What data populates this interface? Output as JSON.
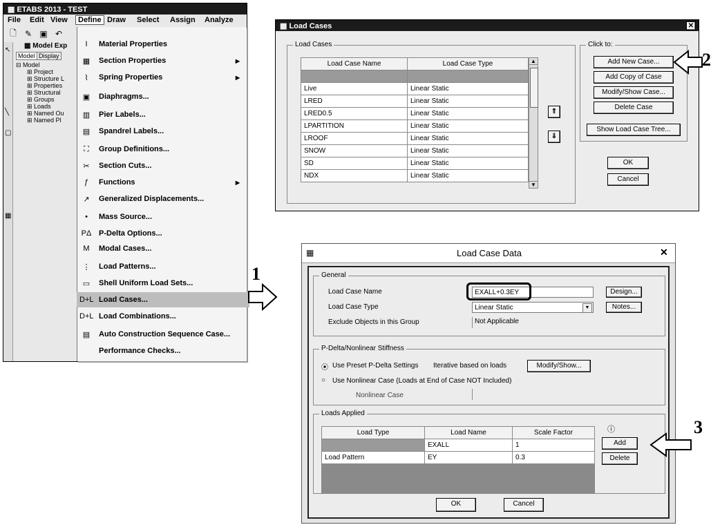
{
  "etabs": {
    "title": "ETABS 2013 - TEST",
    "menubar": [
      "File",
      "Edit",
      "View",
      "Define",
      "Draw",
      "Select",
      "Assign",
      "Analyze"
    ],
    "explorer_title": "Model Exp",
    "explorer_tabs": [
      "Model",
      "Display"
    ],
    "tree": [
      "Model",
      "Project",
      "Structure L",
      "Properties",
      "Structural",
      "Groups",
      "Loads",
      "Named Ou",
      "Named Pl"
    ],
    "define_menu": [
      {
        "label": "Material Properties",
        "icon": "I",
        "submenu": false
      },
      {
        "label": "Section Properties",
        "icon": "▦",
        "submenu": true
      },
      {
        "label": "Spring Properties",
        "icon": "⌇",
        "submenu": true
      },
      {
        "label": "Diaphragms...",
        "icon": "▣",
        "submenu": false
      },
      {
        "label": "Pier Labels...",
        "icon": "▥",
        "submenu": false
      },
      {
        "label": "Spandrel Labels...",
        "icon": "▤",
        "submenu": false
      },
      {
        "label": "Group Definitions...",
        "icon": "⛶",
        "submenu": false
      },
      {
        "label": "Section Cuts...",
        "icon": "✂",
        "submenu": false
      },
      {
        "label": "Functions",
        "icon": "ƒ",
        "submenu": true
      },
      {
        "label": "Generalized Displacements...",
        "icon": "↗",
        "submenu": false
      },
      {
        "label": "Mass Source...",
        "icon": "•",
        "submenu": false
      },
      {
        "label": "P-Delta Options...",
        "icon": "PΔ",
        "submenu": false
      },
      {
        "label": "Modal Cases...",
        "icon": "M",
        "submenu": false
      },
      {
        "label": "Load Patterns...",
        "icon": "⋮",
        "submenu": false
      },
      {
        "label": "Shell Uniform Load Sets...",
        "icon": "▭",
        "submenu": false
      },
      {
        "label": "Load Cases...",
        "icon": "D+L",
        "submenu": false
      },
      {
        "label": "Load Combinations...",
        "icon": "D+L",
        "submenu": false
      },
      {
        "label": "Auto Construction Sequence Case...",
        "icon": "▤",
        "submenu": false
      },
      {
        "label": "Performance Checks...",
        "icon": "",
        "submenu": false
      }
    ]
  },
  "load_cases": {
    "title": "Load Cases",
    "group_label": "Load Cases",
    "headers": [
      "Load Case Name",
      "Load Case Type"
    ],
    "rows": [
      [
        "",
        ""
      ],
      [
        "Live",
        "Linear Static"
      ],
      [
        "LRED",
        "Linear Static"
      ],
      [
        "LRED0.5",
        "Linear Static"
      ],
      [
        "LPARTITION",
        "Linear Static"
      ],
      [
        "LROOF",
        "Linear Static"
      ],
      [
        "SNOW",
        "Linear Static"
      ],
      [
        "SD",
        "Linear Static"
      ],
      [
        "NDX",
        "Linear Static"
      ]
    ],
    "click_to": "Click to:",
    "buttons": [
      "Add New Case...",
      "Add Copy of Case",
      "Modify/Show Case...",
      "Delete Case",
      "Show Load Case Tree..."
    ],
    "ok": "OK",
    "cancel": "Cancel"
  },
  "load_case_data": {
    "title": "Load Case Data",
    "general_label": "General",
    "name_label": "Load Case Name",
    "name_value": "EXALL+0.3EY",
    "design_btn": "Design...",
    "type_label": "Load Case Type",
    "type_value": "Linear Static",
    "notes_btn": "Notes...",
    "exclude_label": "Exclude Objects in this Group",
    "exclude_value": "Not Applicable",
    "pdelta_label": "P-Delta/Nonlinear Stiffness",
    "radio1": "Use Preset P-Delta Settings",
    "radio1_value": "Iterative based on loads",
    "modify_show": "Modify/Show...",
    "radio2": "Use Nonlinear Case (Loads at End of Case NOT Included)",
    "nonlinear_label": "Nonlinear Case",
    "loads_label": "Loads Applied",
    "load_headers": [
      "Load Type",
      "Load Name",
      "Scale Factor"
    ],
    "load_rows": [
      [
        "",
        "EXALL",
        "1"
      ],
      [
        "Load Pattern",
        "EY",
        "0.3"
      ]
    ],
    "add_btn": "Add",
    "delete_btn": "Delete",
    "ok": "OK",
    "cancel": "Cancel"
  },
  "steps": {
    "one": "1",
    "two": "2",
    "three": "3"
  }
}
